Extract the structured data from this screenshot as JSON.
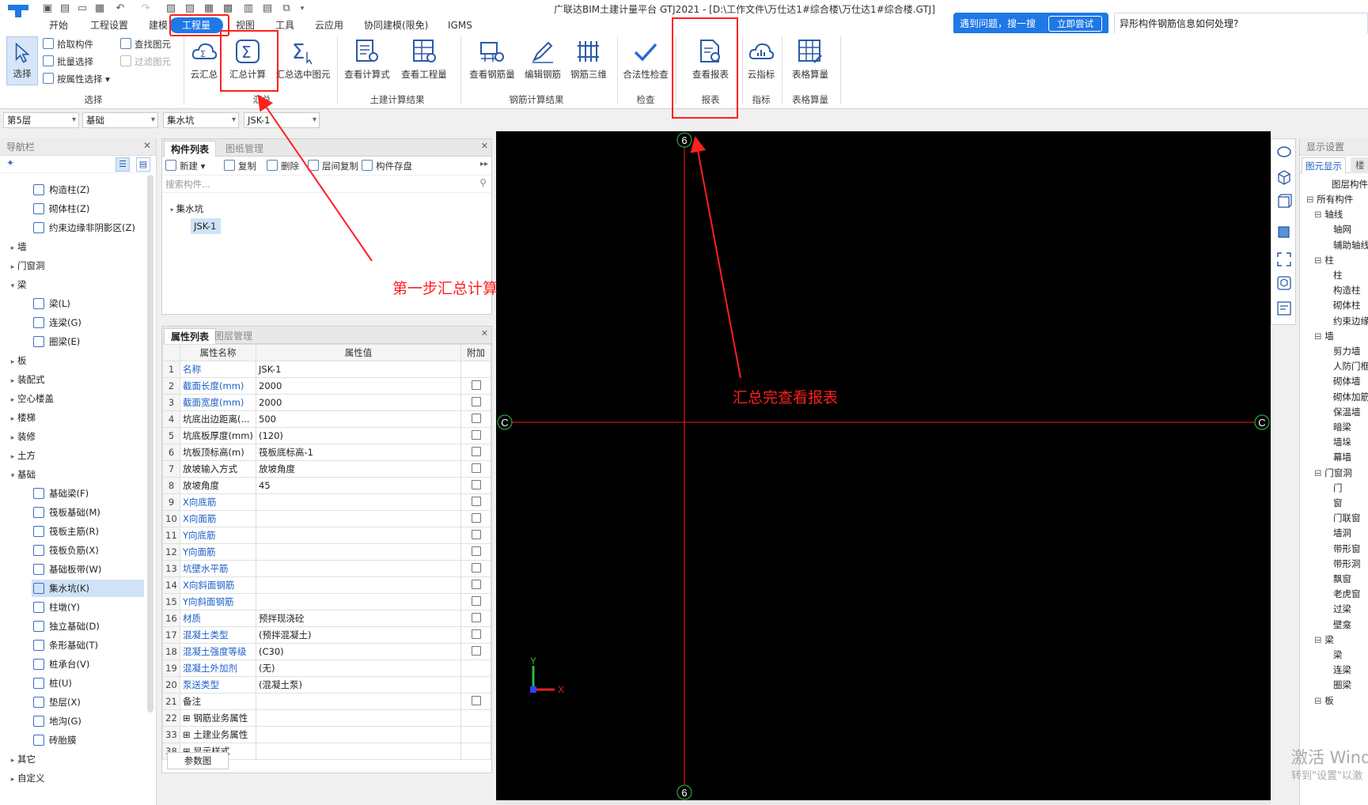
{
  "titlebar": {
    "title": "广联达BIM土建计量平台 GTJ2021 - [D:\\工作文件\\万仕达1#综合楼\\万仕达1#综合楼.GTJ]"
  },
  "menu": {
    "items": [
      "开始",
      "工程设置",
      "建模",
      "工程量",
      "视图",
      "工具",
      "云应用",
      "协同建模(限免)",
      "IGMS"
    ]
  },
  "ribbon": {
    "select": {
      "label": "选择",
      "pick": "拾取构件",
      "batch": "批量选择",
      "attr": "按属性选择",
      "find": "查找图元",
      "filter": "过滤图元",
      "group": "选择"
    },
    "summary": {
      "cloud": "云汇总",
      "calc": "汇总计算",
      "selected": "汇总选中图元",
      "group": "汇总"
    },
    "civil": {
      "view_formula": "查看计算式",
      "view_qty": "查看工程量",
      "group": "土建计算结果"
    },
    "rebar": {
      "view": "查看钢筋量",
      "edit": "编辑钢筋",
      "three_d": "钢筋三维",
      "group": "钢筋计算结果"
    },
    "check": {
      "legal": "合法性检查",
      "group": "检查"
    },
    "report": {
      "view": "查看报表",
      "group": "报表"
    },
    "index": {
      "cloud": "云指标",
      "group": "指标"
    },
    "table": {
      "calc": "表格算量",
      "group": "表格算量"
    }
  },
  "search": {
    "label": "遇到问题，搜一搜",
    "button": "立即尝试",
    "hint": "异形构件钢筋信息如何处理?"
  },
  "toolbar": {
    "floor": "第5层",
    "category": "基础",
    "type": "集水坑",
    "component": "JSK-1"
  },
  "nav": {
    "title": "导航栏",
    "items": [
      {
        "label": "构造柱(Z)",
        "lvl": 2
      },
      {
        "label": "砌体柱(Z)",
        "lvl": 2
      },
      {
        "label": "约束边缘非阴影区(Z)",
        "lvl": 2
      },
      {
        "label": "墙",
        "lvl": 1
      },
      {
        "label": "门窗洞",
        "lvl": 1
      },
      {
        "label": "梁",
        "lvl": 1,
        "open": true
      },
      {
        "label": "梁(L)",
        "lvl": 2
      },
      {
        "label": "连梁(G)",
        "lvl": 2
      },
      {
        "label": "圈梁(E)",
        "lvl": 2
      },
      {
        "label": "板",
        "lvl": 1
      },
      {
        "label": "装配式",
        "lvl": 1
      },
      {
        "label": "空心楼盖",
        "lvl": 1
      },
      {
        "label": "楼梯",
        "lvl": 1
      },
      {
        "label": "装修",
        "lvl": 1
      },
      {
        "label": "土方",
        "lvl": 1
      },
      {
        "label": "基础",
        "lvl": 1,
        "open": true
      },
      {
        "label": "基础梁(F)",
        "lvl": 2
      },
      {
        "label": "筏板基础(M)",
        "lvl": 2
      },
      {
        "label": "筏板主筋(R)",
        "lvl": 2
      },
      {
        "label": "筏板负筋(X)",
        "lvl": 2
      },
      {
        "label": "基础板带(W)",
        "lvl": 2
      },
      {
        "label": "集水坑(K)",
        "lvl": 2,
        "selected": true
      },
      {
        "label": "柱墩(Y)",
        "lvl": 2
      },
      {
        "label": "独立基础(D)",
        "lvl": 2
      },
      {
        "label": "条形基础(T)",
        "lvl": 2
      },
      {
        "label": "桩承台(V)",
        "lvl": 2
      },
      {
        "label": "桩(U)",
        "lvl": 2
      },
      {
        "label": "垫层(X)",
        "lvl": 2
      },
      {
        "label": "地沟(G)",
        "lvl": 2
      },
      {
        "label": "砖胎膜",
        "lvl": 2
      },
      {
        "label": "其它",
        "lvl": 1
      },
      {
        "label": "自定义",
        "lvl": 1
      }
    ]
  },
  "components": {
    "tab_list": "构件列表",
    "tab_drawing": "图纸管理",
    "new": "新建",
    "copy": "复制",
    "delete": "删除",
    "floor_copy": "层间复制",
    "save": "构件存盘",
    "search_placeholder": "搜索构件...",
    "tree_parent": "集水坑",
    "tree_child": "JSK-1"
  },
  "properties": {
    "tab_props": "属性列表",
    "tab_layers": "图层管理",
    "col_name": "属性名称",
    "col_value": "属性值",
    "col_extra": "附加",
    "rows": [
      {
        "no": "1",
        "name": "名称",
        "value": "JSK-1",
        "blue": true,
        "chk": false
      },
      {
        "no": "2",
        "name": "截面长度(mm)",
        "value": "2000",
        "blue": true,
        "chk": true
      },
      {
        "no": "3",
        "name": "截面宽度(mm)",
        "value": "2000",
        "blue": true,
        "chk": true
      },
      {
        "no": "4",
        "name": "坑底出边距离(...",
        "value": "500",
        "blue": false,
        "chk": true
      },
      {
        "no": "5",
        "name": "坑底板厚度(mm)",
        "value": "(120)",
        "blue": false,
        "chk": true
      },
      {
        "no": "6",
        "name": "坑板顶标高(m)",
        "value": "筏板底标高-1",
        "blue": false,
        "chk": true
      },
      {
        "no": "7",
        "name": "放坡输入方式",
        "value": "放坡角度",
        "blue": false,
        "chk": true
      },
      {
        "no": "8",
        "name": "放坡角度",
        "value": "45",
        "blue": false,
        "chk": true
      },
      {
        "no": "9",
        "name": "X向底筋",
        "value": "",
        "blue": true,
        "chk": true
      },
      {
        "no": "10",
        "name": "X向面筋",
        "value": "",
        "blue": true,
        "chk": true
      },
      {
        "no": "11",
        "name": "Y向底筋",
        "value": "",
        "blue": true,
        "chk": true
      },
      {
        "no": "12",
        "name": "Y向面筋",
        "value": "",
        "blue": true,
        "chk": true
      },
      {
        "no": "13",
        "name": "坑壁水平筋",
        "value": "",
        "blue": true,
        "chk": true
      },
      {
        "no": "14",
        "name": "X向斜面钢筋",
        "value": "",
        "blue": true,
        "chk": true
      },
      {
        "no": "15",
        "name": "Y向斜面钢筋",
        "value": "",
        "blue": true,
        "chk": true
      },
      {
        "no": "16",
        "name": "材质",
        "value": "预拌现浇砼",
        "blue": true,
        "chk": true
      },
      {
        "no": "17",
        "name": "混凝土类型",
        "value": "(预拌混凝土)",
        "blue": true,
        "chk": true
      },
      {
        "no": "18",
        "name": "混凝土强度等级",
        "value": "(C30)",
        "blue": true,
        "chk": true
      },
      {
        "no": "19",
        "name": "混凝土外加剂",
        "value": "(无)",
        "blue": true,
        "chk": false
      },
      {
        "no": "20",
        "name": "泵送类型",
        "value": "(混凝土泵)",
        "blue": true,
        "chk": false
      },
      {
        "no": "21",
        "name": "备注",
        "value": "",
        "blue": false,
        "chk": true
      },
      {
        "no": "22",
        "name": "钢筋业务属性",
        "value": "",
        "blue": false,
        "chk": false,
        "expand": true
      },
      {
        "no": "33",
        "name": "土建业务属性",
        "value": "",
        "blue": false,
        "chk": false,
        "expand": true
      },
      {
        "no": "38",
        "name": "显示样式",
        "value": "",
        "blue": false,
        "chk": false,
        "expand": true
      }
    ],
    "params_button": "参数图"
  },
  "canvas": {
    "axis_top": "6",
    "axis_bottom": "6",
    "axis_left": "C",
    "axis_right": "C",
    "coord_y": "Y",
    "coord_x": "X"
  },
  "display": {
    "title": "显示设置",
    "tab1": "图元显示",
    "tab2": "楼",
    "header": "图层构件",
    "rows": [
      {
        "label": "所有构件",
        "lvl": 0,
        "box": true
      },
      {
        "label": "轴线",
        "lvl": 1,
        "box": true
      },
      {
        "label": "轴网",
        "lvl": 2
      },
      {
        "label": "辅助轴线",
        "lvl": 2
      },
      {
        "label": "柱",
        "lvl": 1,
        "box": true
      },
      {
        "label": "柱",
        "lvl": 2
      },
      {
        "label": "构造柱",
        "lvl": 2
      },
      {
        "label": "砌体柱",
        "lvl": 2
      },
      {
        "label": "约束边缘",
        "lvl": 2
      },
      {
        "label": "墙",
        "lvl": 1,
        "box": true
      },
      {
        "label": "剪力墙",
        "lvl": 2
      },
      {
        "label": "人防门框",
        "lvl": 2
      },
      {
        "label": "砌体墙",
        "lvl": 2
      },
      {
        "label": "砌体加筋",
        "lvl": 2
      },
      {
        "label": "保温墙",
        "lvl": 2
      },
      {
        "label": "暗梁",
        "lvl": 2
      },
      {
        "label": "墙垛",
        "lvl": 2
      },
      {
        "label": "幕墙",
        "lvl": 2
      },
      {
        "label": "门窗洞",
        "lvl": 1,
        "box": true
      },
      {
        "label": "门",
        "lvl": 2
      },
      {
        "label": "窗",
        "lvl": 2
      },
      {
        "label": "门联窗",
        "lvl": 2
      },
      {
        "label": "墙洞",
        "lvl": 2
      },
      {
        "label": "带形窗",
        "lvl": 2
      },
      {
        "label": "带形洞",
        "lvl": 2
      },
      {
        "label": "飘窗",
        "lvl": 2
      },
      {
        "label": "老虎窗",
        "lvl": 2
      },
      {
        "label": "过梁",
        "lvl": 2
      },
      {
        "label": "壁龛",
        "lvl": 2
      },
      {
        "label": "梁",
        "lvl": 1,
        "box": true
      },
      {
        "label": "梁",
        "lvl": 2
      },
      {
        "label": "连梁",
        "lvl": 2
      },
      {
        "label": "圈梁",
        "lvl": 2
      },
      {
        "label": "板",
        "lvl": 1,
        "box": true
      }
    ]
  },
  "annotations": {
    "step1": "第一步汇总计算",
    "step2": "汇总完查看报表"
  },
  "watermark": {
    "line1": "激活 Windo",
    "line2": "转到\"设置\"以激"
  },
  "colors": {
    "accent": "#1e78e6",
    "annotation": "#ff1f1f",
    "axis": "#d01010"
  }
}
